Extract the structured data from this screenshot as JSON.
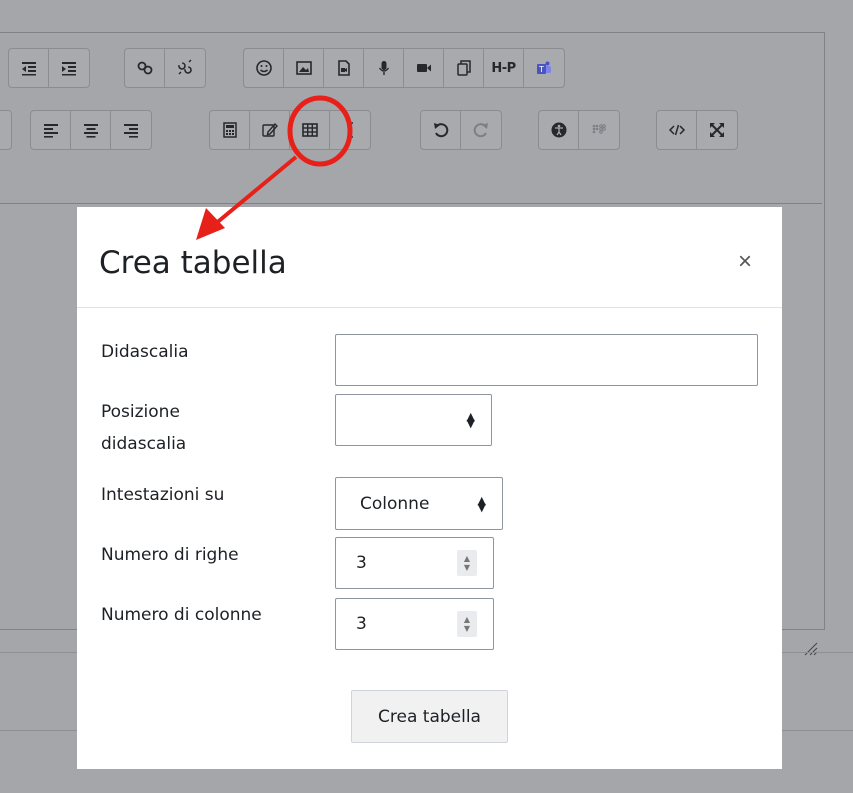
{
  "toolbar": {
    "row1": {
      "group1": [
        "outdent-icon",
        "indent-icon"
      ],
      "group2": [
        "link-icon",
        "unlink-icon"
      ],
      "group3": [
        "emoji-icon",
        "image-icon",
        "media-icon",
        "microphone-icon",
        "video-icon",
        "manage-files-icon",
        "h5p-icon",
        "teams-icon"
      ],
      "h5p_label": "H-P"
    },
    "row2": {
      "group1": [
        "align-left-icon",
        "align-center-icon",
        "align-right-icon"
      ],
      "group2": [
        "calculator-icon",
        "edit-equation-icon",
        "table-icon",
        "text-cursor-icon"
      ],
      "group3": [
        "undo-icon",
        "redo-icon"
      ],
      "group4": [
        "accessibility-icon",
        "screenreader-icon"
      ],
      "group5": [
        "html-icon",
        "fullscreen-icon"
      ]
    }
  },
  "annotation": {
    "color": "#e8201a"
  },
  "dialog": {
    "title": "Crea tabella",
    "close_symbol": "×",
    "fields": {
      "caption": {
        "label": "Didascalia",
        "value": ""
      },
      "caption_position": {
        "label_line1": "Posizione",
        "label_line2": "didascalia",
        "value": ""
      },
      "headers": {
        "label": "Intestazioni su",
        "value": "Colonne"
      },
      "rows": {
        "label": "Numero di righe",
        "value": "3"
      },
      "columns": {
        "label": "Numero di colonne",
        "value": "3"
      }
    },
    "submit_label": "Crea tabella"
  }
}
